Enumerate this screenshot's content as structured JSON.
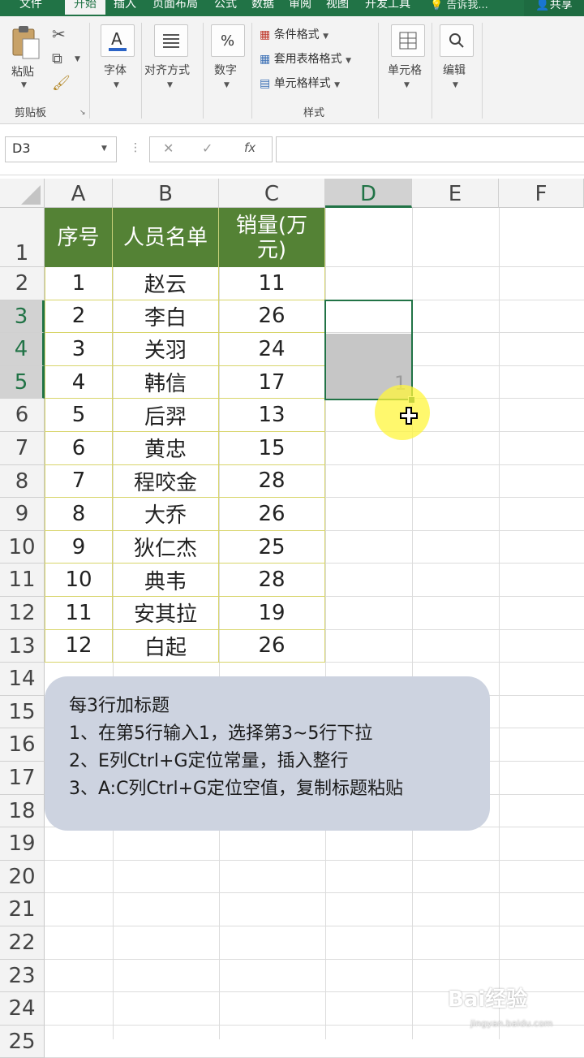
{
  "ribbon_tabs": [
    "文件",
    "开始",
    "插入",
    "页面布局",
    "公式",
    "数据",
    "审阅",
    "视图",
    "开发工具"
  ],
  "tell_me": "告诉我...",
  "share": "共享",
  "clipboard": {
    "paste": "粘贴",
    "group": "剪贴板"
  },
  "ribbon_groups": {
    "font": "字体",
    "alignment": "对齐方式",
    "number": "数字",
    "cells": "单元格",
    "editing": "编辑"
  },
  "styles": {
    "conditional": "条件格式",
    "table": "套用表格格式",
    "cell_styles": "单元格样式",
    "group": "样式"
  },
  "name_box": "D3",
  "formula_bar": {
    "cancel": "✕",
    "enter": "✓",
    "fx": "fx",
    "value": ""
  },
  "columns": [
    "A",
    "B",
    "C",
    "D",
    "E",
    "F"
  ],
  "rows": [
    "1",
    "2",
    "3",
    "4",
    "5",
    "6",
    "7",
    "8",
    "9",
    "10",
    "11",
    "12",
    "13",
    "14",
    "15",
    "16",
    "17",
    "18",
    "19",
    "20",
    "21",
    "22",
    "23",
    "24",
    "25"
  ],
  "table": {
    "headers": {
      "no": "序号",
      "name": "人员名单",
      "sales_l1": "销量(万",
      "sales_l2": "元)"
    },
    "rows": [
      [
        "1",
        "赵云",
        "11"
      ],
      [
        "2",
        "李白",
        "26"
      ],
      [
        "3",
        "关羽",
        "24"
      ],
      [
        "4",
        "韩信",
        "17"
      ],
      [
        "5",
        "后羿",
        "13"
      ],
      [
        "6",
        "黄忠",
        "15"
      ],
      [
        "7",
        "程咬金",
        "28"
      ],
      [
        "8",
        "大乔",
        "26"
      ],
      [
        "9",
        "狄仁杰",
        "25"
      ],
      [
        "10",
        "典韦",
        "28"
      ],
      [
        "11",
        "安其拉",
        "19"
      ],
      [
        "12",
        "白起",
        "26"
      ]
    ]
  },
  "selection_value": "1",
  "note": {
    "title": "每3行加标题",
    "lines": [
      "1、在第5行输入1，选择第3~5行下拉",
      "2、E列Ctrl+G定位常量，插入整行",
      "3、A:C列Ctrl+G定位空值，复制标题粘贴"
    ]
  },
  "watermark": {
    "brand": "Bai经验",
    "url": "jingyan.baidu.com"
  },
  "colors": {
    "accent": "#217346",
    "header_fill": "#548235",
    "note_bg": "#cdd3e0"
  }
}
